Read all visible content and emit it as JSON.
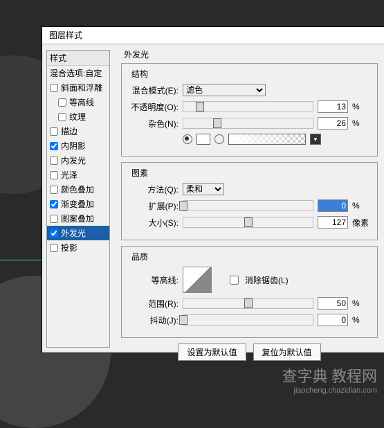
{
  "dialog_title": "图层样式",
  "sidebar": {
    "header": "样式",
    "blend_opts": "混合选项:自定",
    "items": [
      {
        "label": "斜面和浮雕",
        "checked": false,
        "indent": 0
      },
      {
        "label": "等高线",
        "checked": false,
        "indent": 1
      },
      {
        "label": "纹理",
        "checked": false,
        "indent": 1
      },
      {
        "label": "描边",
        "checked": false,
        "indent": 0
      },
      {
        "label": "内阴影",
        "checked": true,
        "indent": 0
      },
      {
        "label": "内发光",
        "checked": false,
        "indent": 0
      },
      {
        "label": "光泽",
        "checked": false,
        "indent": 0
      },
      {
        "label": "颜色叠加",
        "checked": false,
        "indent": 0
      },
      {
        "label": "渐变叠加",
        "checked": true,
        "indent": 0
      },
      {
        "label": "图案叠加",
        "checked": false,
        "indent": 0
      },
      {
        "label": "外发光",
        "checked": true,
        "indent": 0,
        "selected": true
      },
      {
        "label": "投影",
        "checked": false,
        "indent": 0
      }
    ]
  },
  "panel_title": "外发光",
  "struct": {
    "legend": "结构",
    "blend_label": "混合模式(E):",
    "blend_value": "滤色",
    "opacity_label": "不透明度(O):",
    "opacity_value": "13",
    "opacity_unit": "%",
    "noise_label": "杂色(N):",
    "noise_value": "26",
    "noise_unit": "%"
  },
  "element": {
    "legend": "图素",
    "method_label": "方法(Q):",
    "method_value": "柔和",
    "spread_label": "扩展(P):",
    "spread_value": "0",
    "spread_unit": "%",
    "size_label": "大小(S):",
    "size_value": "127",
    "size_unit": "像素"
  },
  "quality": {
    "legend": "品质",
    "contour_label": "等高线:",
    "anti_label": "消除锯齿(L)",
    "range_label": "范围(R):",
    "range_value": "50",
    "range_unit": "%",
    "jitter_label": "抖动(J):",
    "jitter_value": "0",
    "jitter_unit": "%"
  },
  "buttons": {
    "set_default": "设置为默认值",
    "reset_default": "复位为默认值"
  },
  "watermark": {
    "big": "查字典 教程网",
    "small": "jiaocheng.chazidian.com"
  }
}
